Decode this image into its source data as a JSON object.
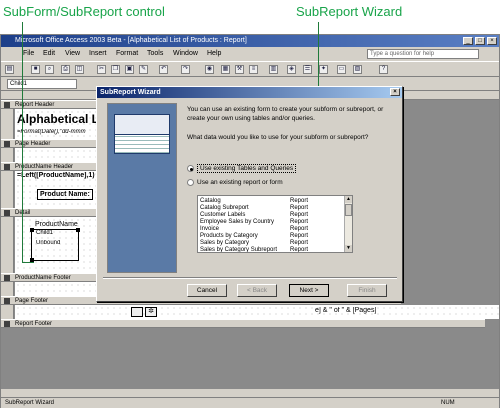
{
  "callouts": {
    "subform_control": "SubForm/SubReport control",
    "wizard": "SubReport Wizard"
  },
  "window": {
    "title": "Microsoft Office Access 2003 Beta - [Alphabetical List of Products : Report]"
  },
  "menu": {
    "items": [
      "File",
      "Edit",
      "View",
      "Insert",
      "Format",
      "Tools",
      "Window",
      "Help"
    ],
    "help_placeholder": "Type a question for help"
  },
  "format_bar": {
    "object_combo": "Child1"
  },
  "report": {
    "bands": {
      "report_header": "Report Header",
      "page_header": "Page Header",
      "product_name_header": "ProductName Header",
      "detail": "Detail",
      "product_name_footer": "ProductName Footer",
      "page_footer": "Page Footer",
      "report_footer": "Report Footer"
    },
    "header_title": "Alphabetical List",
    "header_expr": "=Format(Date(),\"dd-mmm",
    "group_expr": "=Left([ProductName],1)",
    "product_name_label": "Product Name:",
    "detail_field": "ProductName",
    "subreport_label": "Child1",
    "unbound": "Unbound",
    "page_footer_expr": "e] & \" of \" & [Pages]"
  },
  "status": {
    "left": "SubReport Wizard",
    "right": "NUM"
  },
  "wizard": {
    "title": "SubReport Wizard",
    "intro": "You can use an existing form to create your subform or subreport, or create your own using tables and/or queries.",
    "question": "What data would you like to use for your subform or subreport?",
    "option_tables": "Use existing Tables and Queries",
    "option_existing": "Use an existing report or form",
    "list": [
      {
        "name": "Catalog",
        "type": "Report"
      },
      {
        "name": "Catalog Subreport",
        "type": "Report"
      },
      {
        "name": "Customer Labels",
        "type": "Report"
      },
      {
        "name": "Employee Sales by Country",
        "type": "Report"
      },
      {
        "name": "Invoice",
        "type": "Report"
      },
      {
        "name": "Products by Category",
        "type": "Report"
      },
      {
        "name": "Sales by Category",
        "type": "Report"
      },
      {
        "name": "Sales by Category Subreport",
        "type": "Report"
      }
    ],
    "buttons": {
      "cancel": "Cancel",
      "back": "< Back",
      "next": "Next >",
      "finish": "Finish"
    }
  }
}
